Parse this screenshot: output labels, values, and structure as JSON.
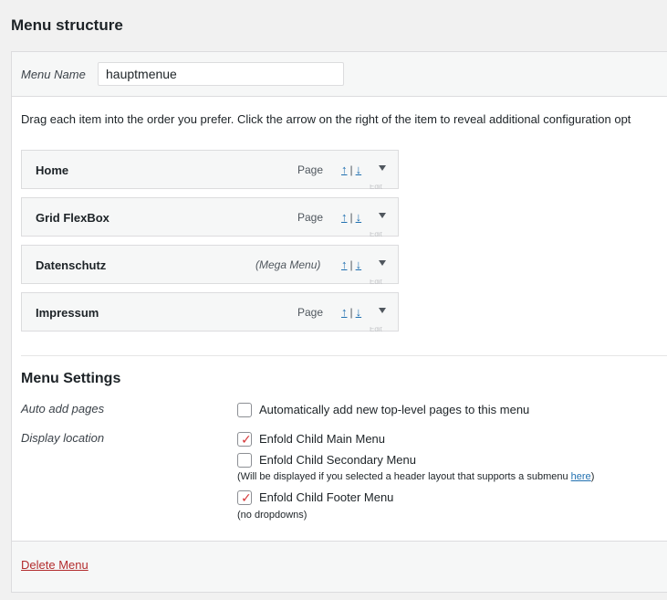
{
  "page": {
    "title": "Menu structure"
  },
  "menu_name": {
    "label": "Menu Name",
    "value": "hauptmenue"
  },
  "instructions": "Drag each item into the order you prefer. Click the arrow on the right of the item to reveal additional configuration opt",
  "menu_items": [
    {
      "title": "Home",
      "type": "Page",
      "move_up": "↑",
      "move_sep": "|",
      "move_down": "↓",
      "edit_peek": "Edit"
    },
    {
      "title": "Grid FlexBox",
      "type": "Page",
      "move_up": "↑",
      "move_sep": "|",
      "move_down": "↓",
      "edit_peek": "Edit"
    },
    {
      "title": "Datenschutz",
      "type": "(Mega Menu)",
      "move_up": "↑",
      "move_sep": "|",
      "move_down": "↓",
      "edit_peek": "Edit"
    },
    {
      "title": "Impressum",
      "type": "Page",
      "move_up": "↑",
      "move_sep": "|",
      "move_down": "↓",
      "edit_peek": "Edit"
    }
  ],
  "settings": {
    "title": "Menu Settings",
    "auto_add": {
      "label": "Auto add pages",
      "option": "Automatically add new top-level pages to this menu",
      "checked": false
    },
    "display_location": {
      "label": "Display location",
      "main_menu": {
        "label": "Enfold Child Main Menu",
        "checked": true
      },
      "secondary_menu": {
        "label": "Enfold Child Secondary Menu",
        "checked": false
      },
      "secondary_note": "(Will be displayed if you selected a header layout that supports a submenu ",
      "secondary_note_link": "here",
      "secondary_note_end": ")",
      "footer_menu": {
        "label": "Enfold Child Footer Menu",
        "checked": true
      },
      "footer_note": "(no dropdowns)"
    }
  },
  "footer": {
    "delete_label": "Delete Menu"
  },
  "colors": {
    "accent": "#2271b1",
    "delete": "#b32d2e",
    "check": "#d63638"
  }
}
